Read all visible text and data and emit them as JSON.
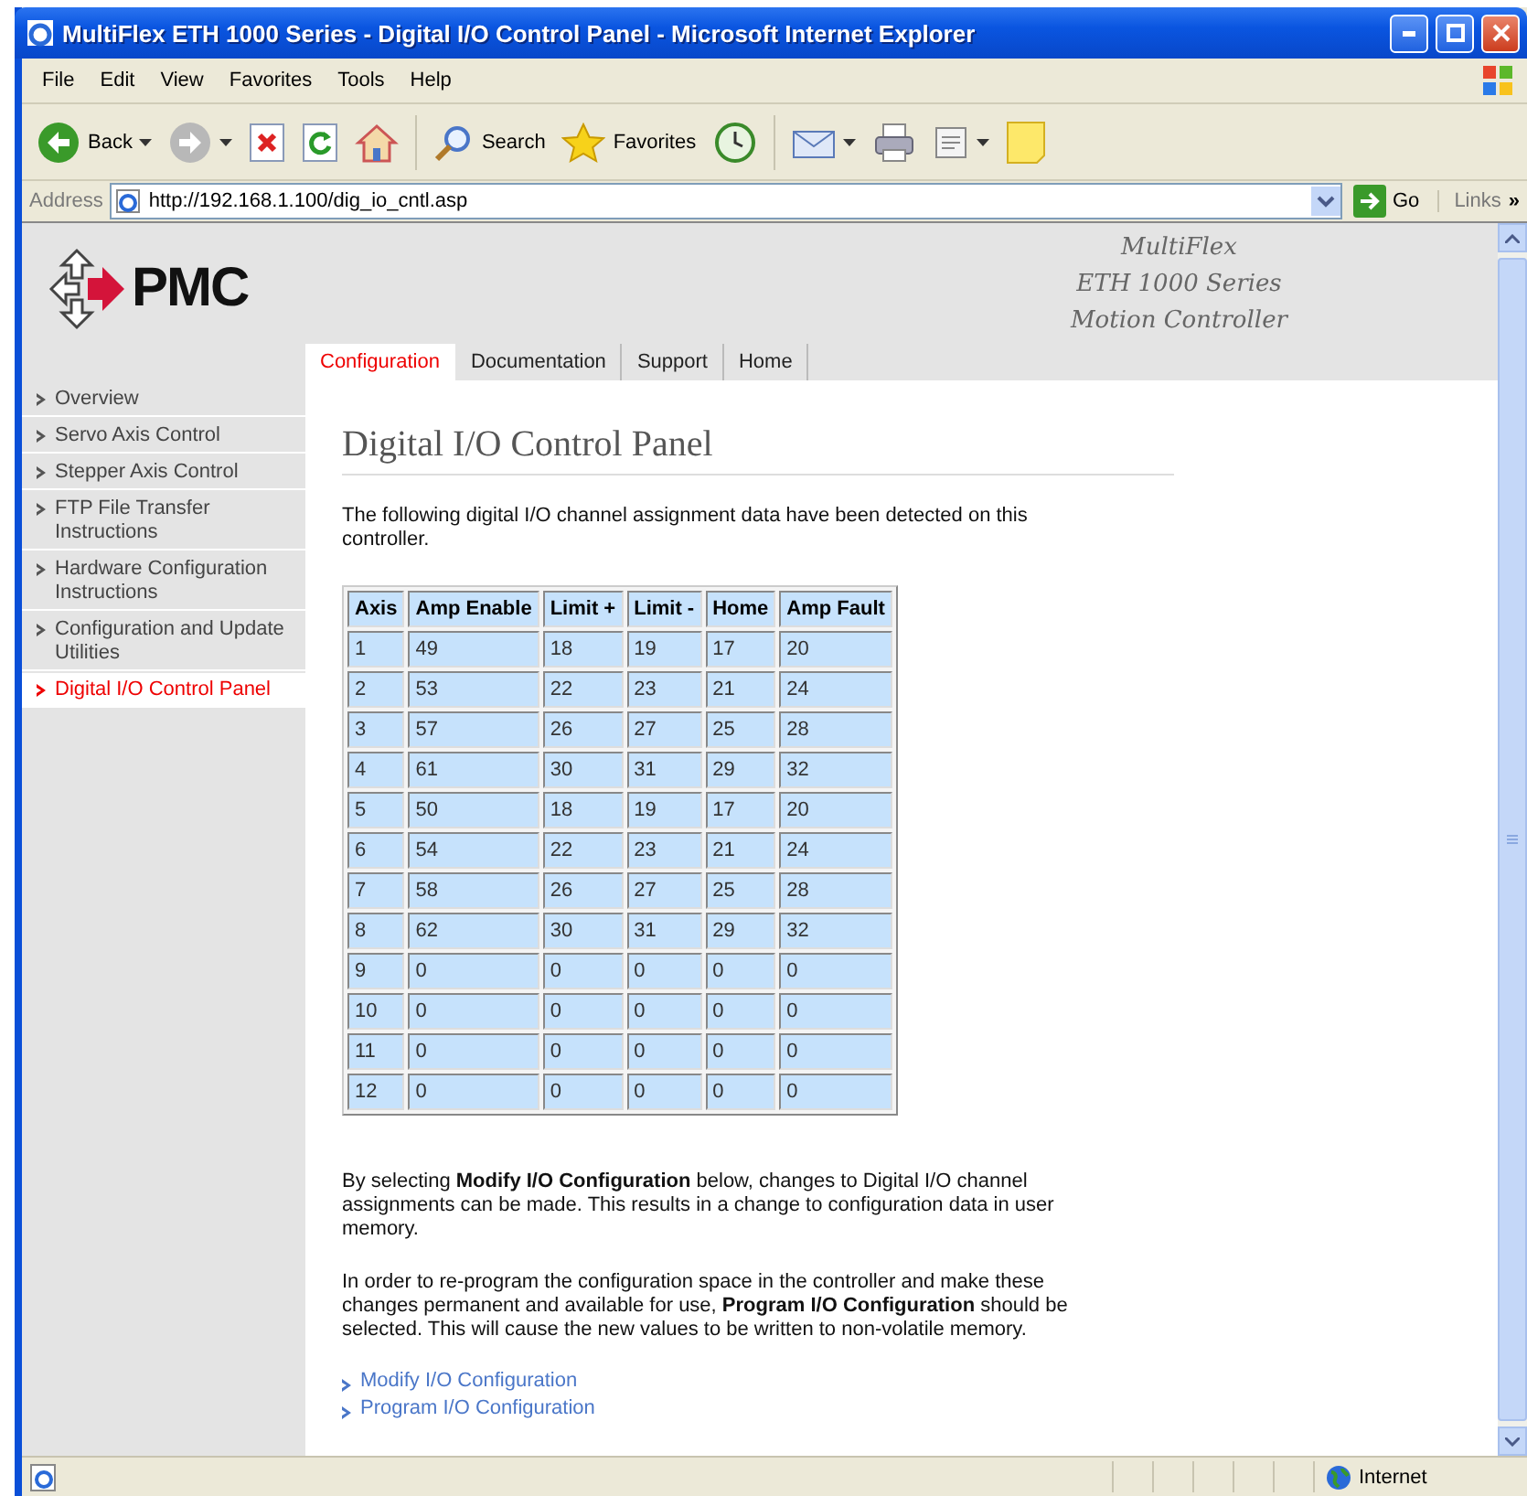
{
  "window": {
    "title": "MultiFlex ETH 1000 Series - Digital I/O Control Panel - Microsoft Internet Explorer"
  },
  "menu": [
    "File",
    "Edit",
    "View",
    "Favorites",
    "Tools",
    "Help"
  ],
  "toolbar": [
    {
      "kind": "back",
      "label": "Back"
    },
    {
      "kind": "forward"
    },
    {
      "kind": "stop"
    },
    {
      "kind": "refresh"
    },
    {
      "kind": "home"
    },
    {
      "kind": "search",
      "label": "Search"
    },
    {
      "kind": "favorites",
      "label": "Favorites"
    },
    {
      "kind": "history"
    },
    {
      "kind": "mail"
    },
    {
      "kind": "print"
    },
    {
      "kind": "edit"
    },
    {
      "kind": "note"
    }
  ],
  "address": {
    "label": "Address",
    "value": "http://192.168.1.100/dig_io_cntl.asp",
    "go": "Go",
    "links": "Links",
    "more": "»"
  },
  "header": {
    "logo": "PMC",
    "product": [
      "MultiFlex",
      "ETH 1000 Series",
      "Motion Controller"
    ]
  },
  "tabs": [
    {
      "label": "Configuration",
      "selected": true
    },
    {
      "label": "Documentation",
      "selected": false
    },
    {
      "label": "Support",
      "selected": false
    },
    {
      "label": "Home",
      "selected": false
    }
  ],
  "sidebar": {
    "items": [
      {
        "label": "Overview",
        "selected": false
      },
      {
        "label": "Servo Axis Control",
        "selected": false
      },
      {
        "label": "Stepper Axis Control",
        "selected": false
      },
      {
        "label": "FTP File Transfer Instructions",
        "selected": false
      },
      {
        "label": "Hardware Configuration Instructions",
        "selected": false
      },
      {
        "label": "Configuration and Update Utilities",
        "selected": false
      },
      {
        "label": "Digital I/O Control Panel",
        "selected": true
      }
    ]
  },
  "main": {
    "heading": "Digital I/O Control Panel",
    "intro": "The following digital I/O channel assignment data have been detected on this controller.",
    "table": {
      "columns": [
        "Axis",
        "Amp Enable",
        "Limit +",
        "Limit -",
        "Home",
        "Amp Fault"
      ],
      "rows": [
        [
          "1",
          "49",
          "18",
          "19",
          "17",
          "20"
        ],
        [
          "2",
          "53",
          "22",
          "23",
          "21",
          "24"
        ],
        [
          "3",
          "57",
          "26",
          "27",
          "25",
          "28"
        ],
        [
          "4",
          "61",
          "30",
          "31",
          "29",
          "32"
        ],
        [
          "5",
          "50",
          "18",
          "19",
          "17",
          "20"
        ],
        [
          "6",
          "54",
          "22",
          "23",
          "21",
          "24"
        ],
        [
          "7",
          "58",
          "26",
          "27",
          "25",
          "28"
        ],
        [
          "8",
          "62",
          "30",
          "31",
          "29",
          "32"
        ],
        [
          "9",
          "0",
          "0",
          "0",
          "0",
          "0"
        ],
        [
          "10",
          "0",
          "0",
          "0",
          "0",
          "0"
        ],
        [
          "11",
          "0",
          "0",
          "0",
          "0",
          "0"
        ],
        [
          "12",
          "0",
          "0",
          "0",
          "0",
          "0"
        ]
      ]
    },
    "paragraphs": [
      "By selecting **Modify I/O Configuration** below, changes to Digital I/O channel assignments can be made. This results in a change to configuration data in user memory.",
      "In order to re-program the configuration space in the controller and make these changes permanent and available for use, **Program I/O Configuration** should be selected. This will cause the new values to be written to non-volatile memory."
    ],
    "links": [
      "Modify I/O Configuration",
      "Program I/O Configuration"
    ]
  },
  "status_bar": {
    "zone": "Internet"
  }
}
